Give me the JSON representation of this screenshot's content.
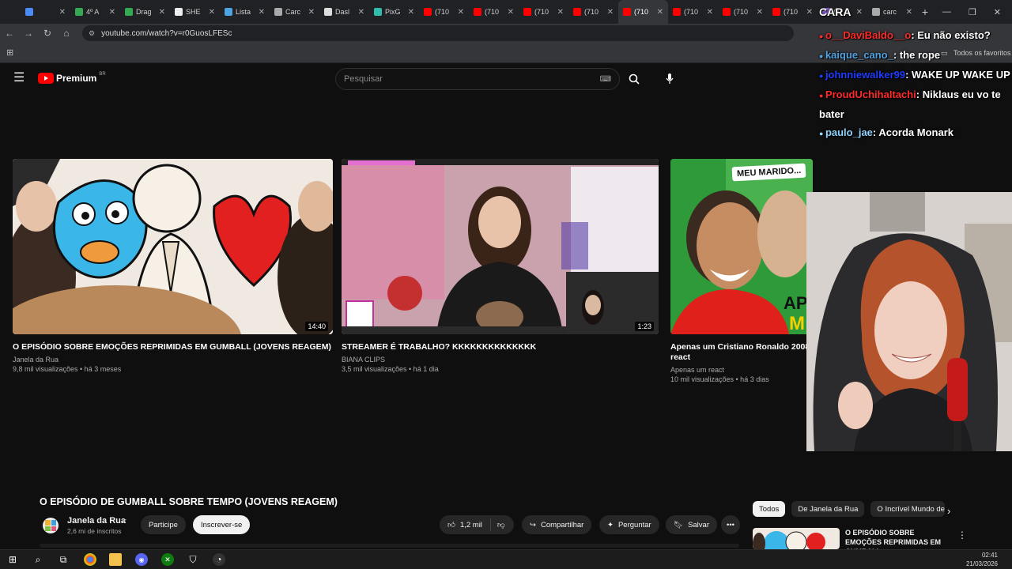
{
  "browser": {
    "tabs": [
      {
        "label": "",
        "color": "#4c8bf5"
      },
      {
        "label": "4º A",
        "color": "#34a853"
      },
      {
        "label": "Drag",
        "color": "#34a853"
      },
      {
        "label": "SHE",
        "color": "#eeeeee"
      },
      {
        "label": "Lista",
        "color": "#4fa3e0"
      },
      {
        "label": "Carc",
        "color": "#aaaaaa"
      },
      {
        "label": "Dasl",
        "color": "#dddddd"
      },
      {
        "label": "PixG",
        "color": "#32bcad"
      },
      {
        "label": "(710",
        "color": "#ff0000"
      },
      {
        "label": "(710",
        "color": "#ff0000"
      },
      {
        "label": "(710",
        "color": "#ff0000"
      },
      {
        "label": "(710",
        "color": "#ff0000"
      },
      {
        "label": "(710",
        "color": "#ff0000",
        "active": true
      },
      {
        "label": "(710",
        "color": "#ff0000"
      },
      {
        "label": "(710",
        "color": "#ff0000"
      },
      {
        "label": "(710",
        "color": "#ff0000"
      },
      {
        "label": "(4",
        "color": "#8a63d2"
      },
      {
        "label": "carc",
        "color": "#aaaaaa"
      }
    ],
    "new_tab": "+",
    "url": "youtube.com/watch?v=r0GuosLFESc",
    "bookmarks_label": "Todos os favoritos"
  },
  "youtube": {
    "logo": "Premium",
    "logo_region": "BR",
    "search_placeholder": "Pesquisar",
    "videos": [
      {
        "title": "O EPISÓDIO SOBRE EMOÇÕES REPRIMIDAS EM GUMBALL (JOVENS REAGEM)",
        "channel": "Janela da Rua",
        "meta": "9,8 mil visualizações • há 3 meses",
        "duration": "14:40"
      },
      {
        "title": "STREAMER É TRABALHO? KKKKKKKKKKKKKK",
        "channel": "BIANA CLIPS",
        "meta": "3,5 mil visualizações • há 1 dia",
        "duration": "1:23"
      },
      {
        "title": "Apenas um Cristiano Ronaldo 2008 react",
        "channel": "Apenas um react",
        "meta": "10 mil visualizações • há 3 dias",
        "duration": ""
      }
    ],
    "thumb_text": {
      "meu_marido": "MEU MARIDO..."
    },
    "watch": {
      "title": "O EPISÓDIO DE GUMBALL SOBRE TEMPO (JOVENS REAGEM)",
      "channel": "Janela da Rua",
      "subscribers": "2,6 mi de inscritos",
      "join": "Participe",
      "subscribe": "Inscrever-se",
      "likes": "1,2 mil",
      "share": "Compartilhar",
      "ask": "Perguntar",
      "save": "Salvar"
    },
    "chips": [
      "Todos",
      "De Janela da Rua",
      "O Incrível Mundo de"
    ],
    "sidebar_video": {
      "title": "O EPISÓDIO SOBRE EMOÇÕES REPRIMIDAS EM GUMBALL ..."
    }
  },
  "chat": {
    "header": "CARA",
    "messages": [
      {
        "user": "o__DaviBaldo__o",
        "text": ": Eu não existo?",
        "color": "#ff2a2a"
      },
      {
        "user": "kaique_cano_",
        "text": ": the rope",
        "color": "#4fa3e0"
      },
      {
        "user": "johnniewalker99",
        "text": ": WAKE UP WAKE UP",
        "color": "#1e3cff"
      },
      {
        "user": "ProudUchihaItachi",
        "text": ": Niklaus eu vo te bater",
        "color": "#ff2a2a"
      },
      {
        "user": "paulo_jae",
        "text": ": Acorda Monark",
        "color": "#8fd3ff"
      }
    ]
  },
  "taskbar": {
    "time": "02:41",
    "date": "21/03/2026"
  }
}
